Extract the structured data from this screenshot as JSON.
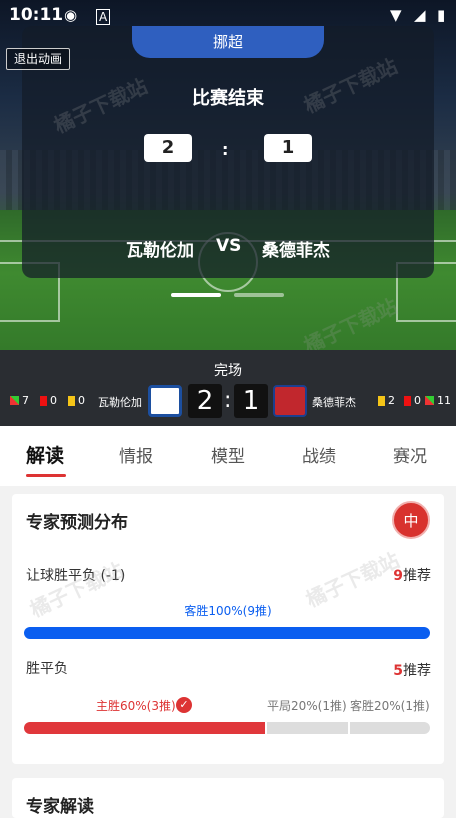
{
  "statusbar": {
    "time": "10:11"
  },
  "hero": {
    "league": "挪超",
    "exit_label": "退出动画",
    "status": "比赛结束",
    "home_score": "2",
    "away_score": "1",
    "colon": ":",
    "home_team": "瓦勒伦加",
    "vs": "VS",
    "away_team": "桑德菲杰"
  },
  "match_bar": {
    "status": "完场",
    "home": {
      "flags": "7",
      "red": "0",
      "yellow": "0",
      "name": "瓦勒伦加",
      "score": "2"
    },
    "colon": ":",
    "away": {
      "yellow": "2",
      "red": "0",
      "flags": "11",
      "name": "桑德菲杰",
      "score": "1"
    }
  },
  "tabs": [
    "解读",
    "情报",
    "模型",
    "战绩",
    "赛况"
  ],
  "panel": {
    "title": "专家预测分布",
    "badge": "中",
    "handicap": {
      "label": "让球胜平负 (-1)",
      "count": "9",
      "suffix": "推荐",
      "caption": "客胜100%(9推)",
      "fill": 1.0
    },
    "wdl": {
      "label": "胜平负",
      "count": "5",
      "suffix": "推荐",
      "home": "主胜60%(3推)",
      "draw": "平局20%(1推)",
      "away": "客胜20%(1推)",
      "home_frac": 0.6,
      "draw_frac": 0.2,
      "away_frac": 0.2
    }
  },
  "panel2": {
    "title": "专家解读"
  },
  "watermark": "橘子下载站",
  "colors": {
    "accent": "#d33",
    "blue": "#0a5ef0",
    "league": "#2f5fbf"
  }
}
